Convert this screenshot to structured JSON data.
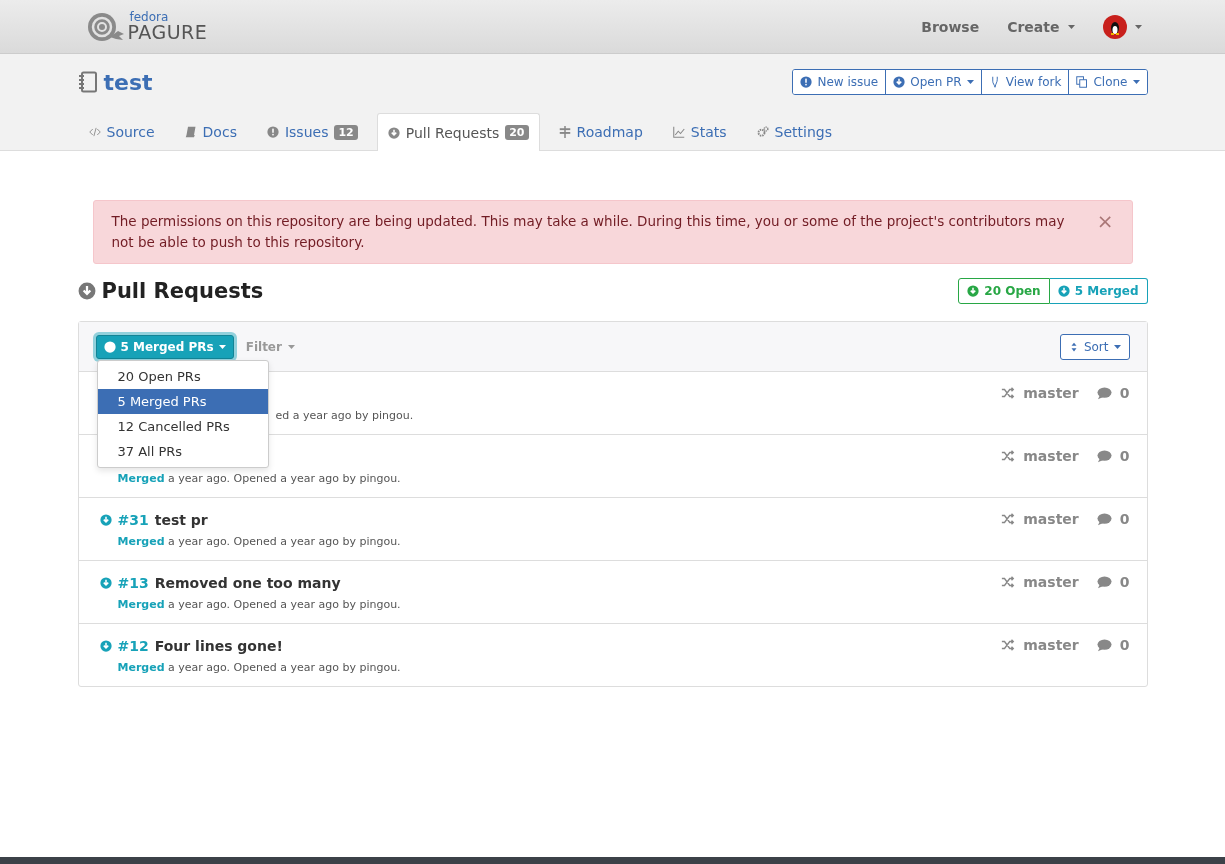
{
  "header": {
    "logo": {
      "small": "fedora",
      "big": "PAGURE"
    },
    "nav": [
      {
        "label": "Browse",
        "dropdown": false
      },
      {
        "label": "Create",
        "dropdown": true
      }
    ]
  },
  "repo": {
    "name": "test",
    "actions": [
      {
        "label": "New issue",
        "dropdown": false
      },
      {
        "label": "Open PR",
        "dropdown": true
      },
      {
        "label": "View fork",
        "dropdown": false
      },
      {
        "label": "Clone",
        "dropdown": true
      }
    ]
  },
  "tabs": [
    {
      "label": "Source",
      "selected": false
    },
    {
      "label": "Docs",
      "selected": false
    },
    {
      "label": "Issues",
      "count": "12",
      "selected": false
    },
    {
      "label": "Pull Requests",
      "count": "20",
      "selected": true
    },
    {
      "label": "Roadmap",
      "selected": false
    },
    {
      "label": "Stats",
      "selected": false
    },
    {
      "label": "Settings",
      "selected": false
    }
  ],
  "alert": {
    "message": "The permissions on this repository are being updated. This may take a while. During this time, you or some of the project's contributors may not be able to push to this repository.",
    "close": "×"
  },
  "section": {
    "title": "Pull Requests",
    "counters": [
      {
        "label": "20 Open",
        "color": "#28a745"
      },
      {
        "label": "5 Merged",
        "color": "#17a2b8"
      }
    ]
  },
  "toolbar": {
    "status_button": "5 Merged PRs",
    "filter": "Filter",
    "sort": "Sort"
  },
  "status_menu": [
    {
      "label": "20 Open PRs",
      "selected": false
    },
    {
      "label": "5 Merged PRs",
      "selected": true
    },
    {
      "label": "12 Cancelled PRs",
      "selected": false
    },
    {
      "label": "37 All PRs",
      "selected": false
    }
  ],
  "pull_requests": [
    {
      "kind": "covered",
      "meta": "ed a year ago by pingou.",
      "branch": "master",
      "comments": "0"
    },
    {
      "kind": "full",
      "status": "Merged",
      "meta": "a year ago. Opened a year ago by pingou.",
      "branch": "master",
      "comments": "0"
    },
    {
      "kind": "full",
      "number": "#31",
      "title": "test pr",
      "status": "Merged",
      "meta": "a year ago. Opened a year ago by pingou.",
      "branch": "master",
      "comments": "0"
    },
    {
      "kind": "full",
      "number": "#13",
      "title": "Removed one too many",
      "status": "Merged",
      "meta": "a year ago. Opened a year ago by pingou.",
      "branch": "master",
      "comments": "0"
    },
    {
      "kind": "full",
      "number": "#12",
      "title": "Four lines gone!",
      "status": "Merged",
      "meta": "a year ago. Opened a year ago by pingou.",
      "branch": "master",
      "comments": "0"
    }
  ]
}
